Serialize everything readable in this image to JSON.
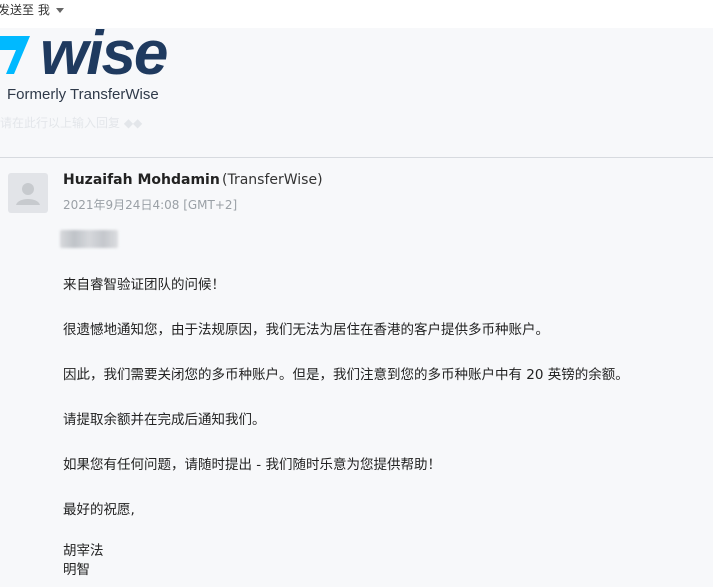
{
  "header": {
    "recipient_label": "发送至 我"
  },
  "brand": {
    "wordmark": "wise",
    "tagline": "Formerly TransferWise",
    "faint_line": "请在此行以上输入回复 ◆◆"
  },
  "message": {
    "sender_name": "Huzaifah Mohdamin",
    "sender_org": "(TransferWise)",
    "date": "2021年9月24日4:08 [GMT+2]",
    "greeting": "来自睿智验证团队的问候！",
    "paragraphs": [
      "很遗憾地通知您，由于法规原因，我们无法为居住在香港的客户提供多币种账户。",
      "因此，我们需要关闭您的多币种账户。但是，我们注意到您的多币种账户中有 20 英镑的余额。",
      "请提取余额并在完成后通知我们。",
      "如果您有任何问题，请随时提出 - 我们随时乐意为您提供帮助！"
    ],
    "closing": "最好的祝愿,",
    "signature": [
      "胡宰法",
      "明智"
    ]
  },
  "colors": {
    "brand_blue": "#1f3a5f",
    "brand_cyan": "#00b9ff"
  }
}
